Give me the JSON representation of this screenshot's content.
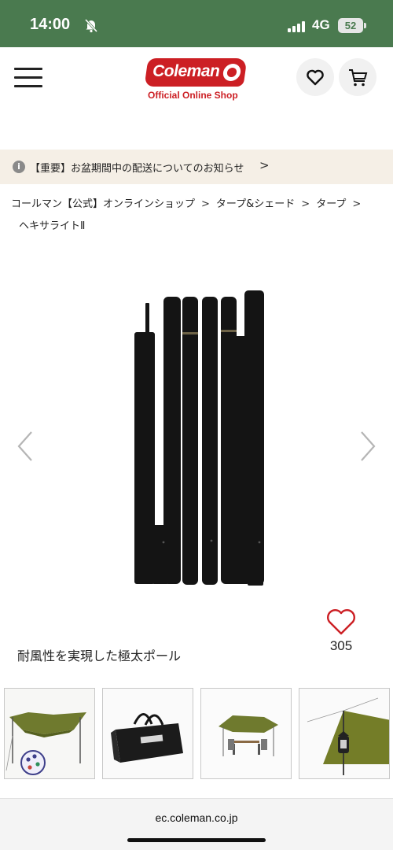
{
  "status_bar": {
    "time": "14:00",
    "network": "4G",
    "battery": "52"
  },
  "header": {
    "logo_text": "Coleman",
    "tagline": "Official Online Shop"
  },
  "notice": {
    "icon": "i",
    "text": "【重要】お盆期間中の配送についてのお知らせ",
    "arrow": ">"
  },
  "breadcrumb": {
    "items": [
      "コールマン【公式】オンラインショップ",
      "タープ&シェード",
      "タープ",
      "ヘキサライトⅡ"
    ],
    "separator": ">"
  },
  "product": {
    "catch": "耐風性を実現した極太ポール",
    "like_count": "305"
  },
  "thumbnails": [
    {
      "name": "hexa-tarp"
    },
    {
      "name": "carry-bag"
    },
    {
      "name": "tarp-setup"
    },
    {
      "name": "tarp-lantern"
    }
  ],
  "browser": {
    "url": "ec.coleman.co.jp"
  },
  "colors": {
    "status_bar": "#4a7a4f",
    "brand_red": "#cc1f24",
    "notice_bg": "#f5efe6",
    "like_red": "#cc1f24"
  }
}
